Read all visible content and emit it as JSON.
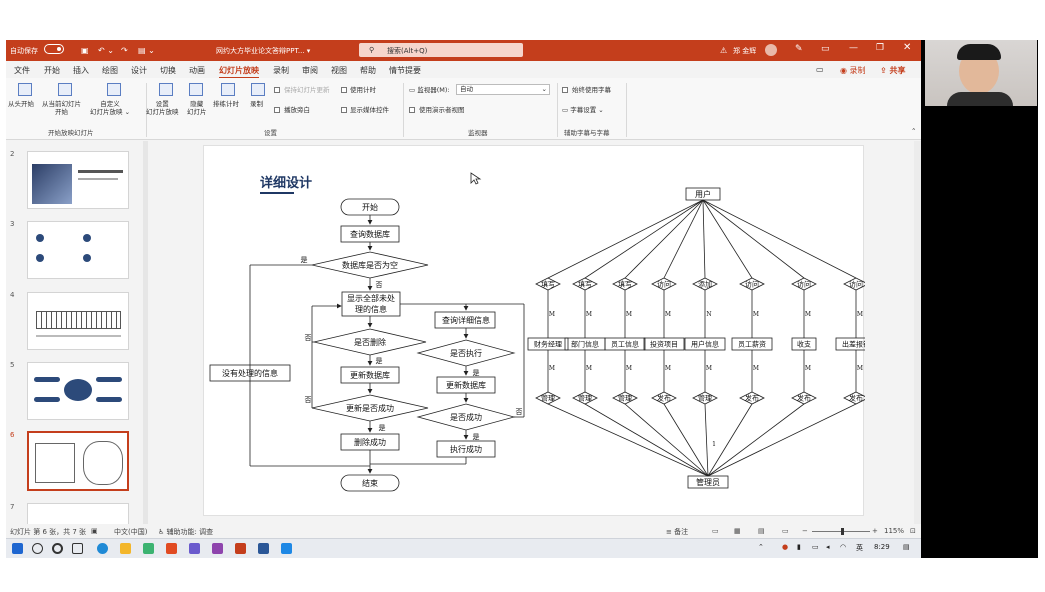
{
  "titlebar": {
    "autosave_label": "自动保存",
    "autosave_state": "关",
    "doc_title": "网约大方毕业论文答辩PPT... ▾",
    "search_placeholder": "搜索(Alt+Q)",
    "user_name": "郑 金辉",
    "warning_icon": "warning-icon"
  },
  "menu": {
    "items": [
      "文件",
      "开始",
      "插入",
      "绘图",
      "设计",
      "切换",
      "动画",
      "幻灯片放映",
      "录制",
      "审阅",
      "视图",
      "帮助",
      "情节提要"
    ],
    "active": "幻灯片放映",
    "record_label": "录制",
    "share_label": "共享"
  },
  "ribbon": {
    "from_start": "从头开始",
    "from_current_1": "从当前幻灯片",
    "from_current_2": "开始",
    "custom_1": "自定义",
    "custom_2": "幻灯片放映 ⌄",
    "group_start": "开始放映幻灯片",
    "setup_1": "设置",
    "setup_2": "幻灯片放映",
    "hide_1": "隐藏",
    "hide_2": "幻灯片",
    "rehearse": "排练计时",
    "record": "录制",
    "keep_fresh": "保持幻灯片更新",
    "use_timing": "使用计时",
    "play_narration": "播放旁白",
    "show_media": "显示媒体控件",
    "group_setup": "设置",
    "monitor_label": "监视器(M):",
    "monitor_value": "自动",
    "presenter_view": "使用演示者视图",
    "group_monitor": "监视器",
    "always_subtitles": "始终使用字幕",
    "subtitle_settings": "字幕设置 ⌄",
    "group_caption": "辅助字幕与字幕"
  },
  "thumbs": {
    "numbers": [
      "2",
      "3",
      "4",
      "5",
      "6",
      "7"
    ],
    "selected": "6"
  },
  "slide": {
    "title": "详细设计",
    "flow": {
      "start": "开始",
      "query_db": "查询数据库",
      "db_empty": "数据库是否为空",
      "yes": "是",
      "no": "否",
      "show_unprocessed_1": "显示全部未处",
      "show_unprocessed_2": "理的信息",
      "no_unprocessed": "没有处理的信息",
      "delete_q": "是否删除",
      "update_db": "更新数据库",
      "update_success_q": "更新是否成功",
      "delete_success": "删除成功",
      "end": "结束",
      "query_detail": "查询详细信息",
      "execute_q": "是否执行",
      "update_db2": "更新数据库",
      "success_q": "是否成功",
      "exec_success": "执行成功"
    },
    "er": {
      "user": "用户",
      "admin": "管理员",
      "top_rel": [
        "填写",
        "填写",
        "填写",
        "访问",
        "添加",
        "访问",
        "访问",
        "访问"
      ],
      "entities": [
        "财务经理",
        "部门信息",
        "员工信息",
        "投资项目",
        "用户信息",
        "员工薪资",
        "收支",
        "出差报销"
      ],
      "bottom_rel": [
        "管理",
        "管理",
        "管理",
        "发布",
        "管理",
        "发布",
        "发布",
        "发布"
      ],
      "card_m": "M",
      "card_n": "N",
      "card_1": "1"
    }
  },
  "status": {
    "slide_info": "幻灯片 第 6 张，共 7 张",
    "language": "中文(中国)",
    "accessibility": "辅助功能: 调查",
    "notes": "备注",
    "zoom": "115%"
  },
  "taskbar": {
    "time": "8:29",
    "ime": "英"
  }
}
